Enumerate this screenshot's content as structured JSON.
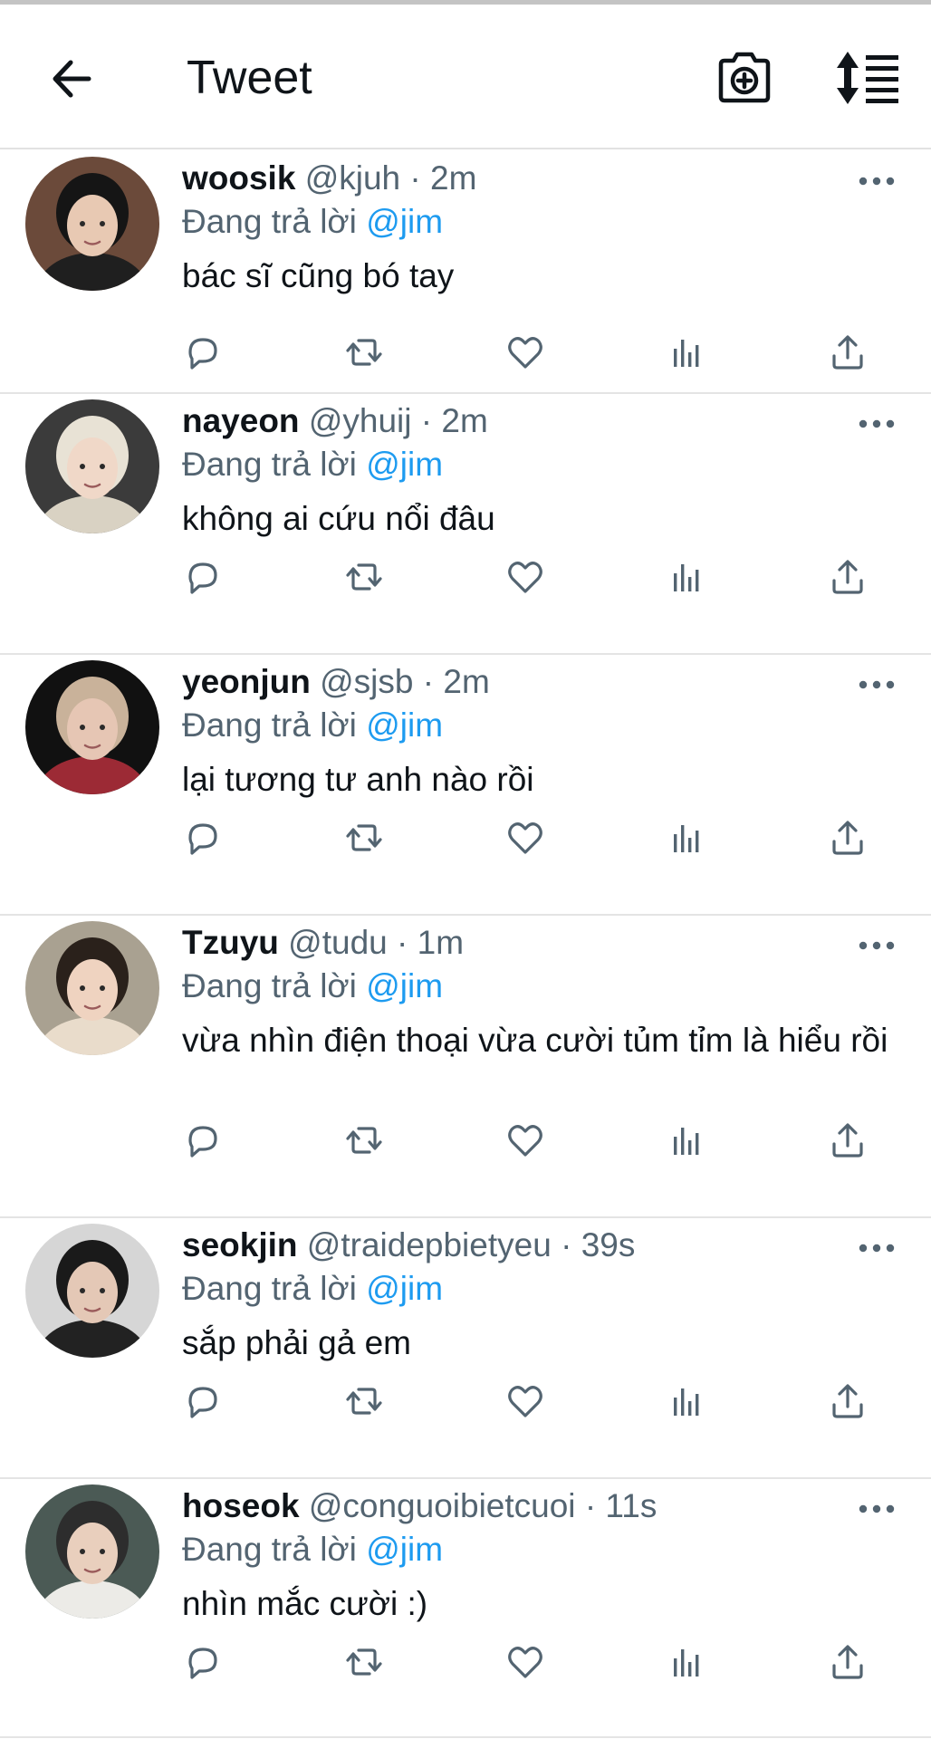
{
  "header": {
    "title": "Tweet",
    "back_icon": "arrow-left-icon",
    "camera_icon": "camera-add-icon",
    "sort_icon": "sort-list-icon"
  },
  "colors": {
    "accent": "#1d9bf0",
    "text": "#0f1419",
    "secondary": "#536471",
    "divider": "#e4e4e4"
  },
  "tweets": [
    {
      "name": "woosik",
      "handle": "@kjuh",
      "time": "2m",
      "reply_prefix": "Đang trả lời",
      "mention": "@jim",
      "text": "bác sĩ cũng bó tay"
    },
    {
      "name": "nayeon",
      "handle": "@yhuij",
      "time": "2m",
      "reply_prefix": "Đang trả lời",
      "mention": "@jim",
      "text": "không ai cứu nổi đâu"
    },
    {
      "name": "yeonjun",
      "handle": "@sjsb",
      "time": "2m",
      "reply_prefix": "Đang trả lời",
      "mention": "@jim",
      "text": "lại tương tư anh nào rồi"
    },
    {
      "name": "Tzuyu",
      "handle": "@tudu",
      "time": "1m",
      "reply_prefix": "Đang trả lời",
      "mention": "@jim",
      "text": "vừa nhìn điện thoại vừa cười tủm tỉm là hiểu rồi"
    },
    {
      "name": "seokjin",
      "handle": "@traidepbietyeu",
      "time": "39s",
      "reply_prefix": "Đang trả lời",
      "mention": "@jim",
      "text": "sắp phải gả em"
    },
    {
      "name": "hoseok",
      "handle": "@conguoibietcuoi",
      "time": "11s",
      "reply_prefix": "Đang trả lời",
      "mention": "@jim",
      "text": "nhìn mắc cười :)"
    }
  ],
  "tweet_separator": "·",
  "action_icons": [
    "reply-icon",
    "retweet-icon",
    "like-icon",
    "views-icon",
    "share-icon"
  ]
}
